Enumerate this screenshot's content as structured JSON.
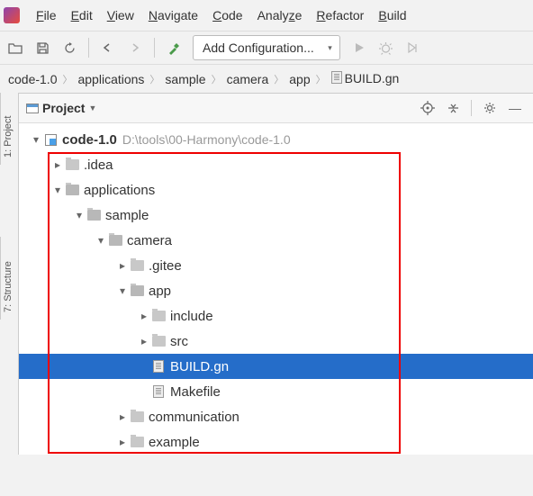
{
  "menu": {
    "items": [
      {
        "label": "File",
        "key": "F"
      },
      {
        "label": "Edit",
        "key": "E"
      },
      {
        "label": "View",
        "key": "V"
      },
      {
        "label": "Navigate",
        "key": "N"
      },
      {
        "label": "Code",
        "key": "C"
      },
      {
        "label": "Analyze",
        "key": ""
      },
      {
        "label": "Refactor",
        "key": "R"
      },
      {
        "label": "Build",
        "key": "B"
      }
    ]
  },
  "toolbar": {
    "config_label": "Add Configuration..."
  },
  "breadcrumb": {
    "items": [
      "code-1.0",
      "applications",
      "sample",
      "camera",
      "app",
      "BUILD.gn"
    ]
  },
  "panel": {
    "title": "Project"
  },
  "tree": {
    "root_name": "code-1.0",
    "root_path": "D:\\tools\\00-Harmony\\code-1.0",
    "nodes": [
      {
        "indent": 0,
        "arrow": "down",
        "icon": "module",
        "label": "code-1.0",
        "path": "D:\\tools\\00-Harmony\\code-1.0"
      },
      {
        "indent": 1,
        "arrow": "right",
        "icon": "folder",
        "label": ".idea"
      },
      {
        "indent": 1,
        "arrow": "down",
        "icon": "folder",
        "label": "applications"
      },
      {
        "indent": 2,
        "arrow": "down",
        "icon": "folder",
        "label": "sample"
      },
      {
        "indent": 3,
        "arrow": "down",
        "icon": "folder",
        "label": "camera"
      },
      {
        "indent": 4,
        "arrow": "right",
        "icon": "folder",
        "label": ".gitee"
      },
      {
        "indent": 4,
        "arrow": "down",
        "icon": "folder",
        "label": "app"
      },
      {
        "indent": 5,
        "arrow": "right",
        "icon": "folder",
        "label": "include"
      },
      {
        "indent": 5,
        "arrow": "right",
        "icon": "folder",
        "label": "src"
      },
      {
        "indent": 5,
        "arrow": "",
        "icon": "file",
        "label": "BUILD.gn",
        "selected": true
      },
      {
        "indent": 5,
        "arrow": "",
        "icon": "file",
        "label": "Makefile"
      },
      {
        "indent": 4,
        "arrow": "right",
        "icon": "folder",
        "label": "communication"
      },
      {
        "indent": 4,
        "arrow": "right",
        "icon": "folder",
        "label": "example"
      }
    ]
  },
  "sidebar": {
    "tabs": [
      "1: Project",
      "7: Structure"
    ]
  }
}
